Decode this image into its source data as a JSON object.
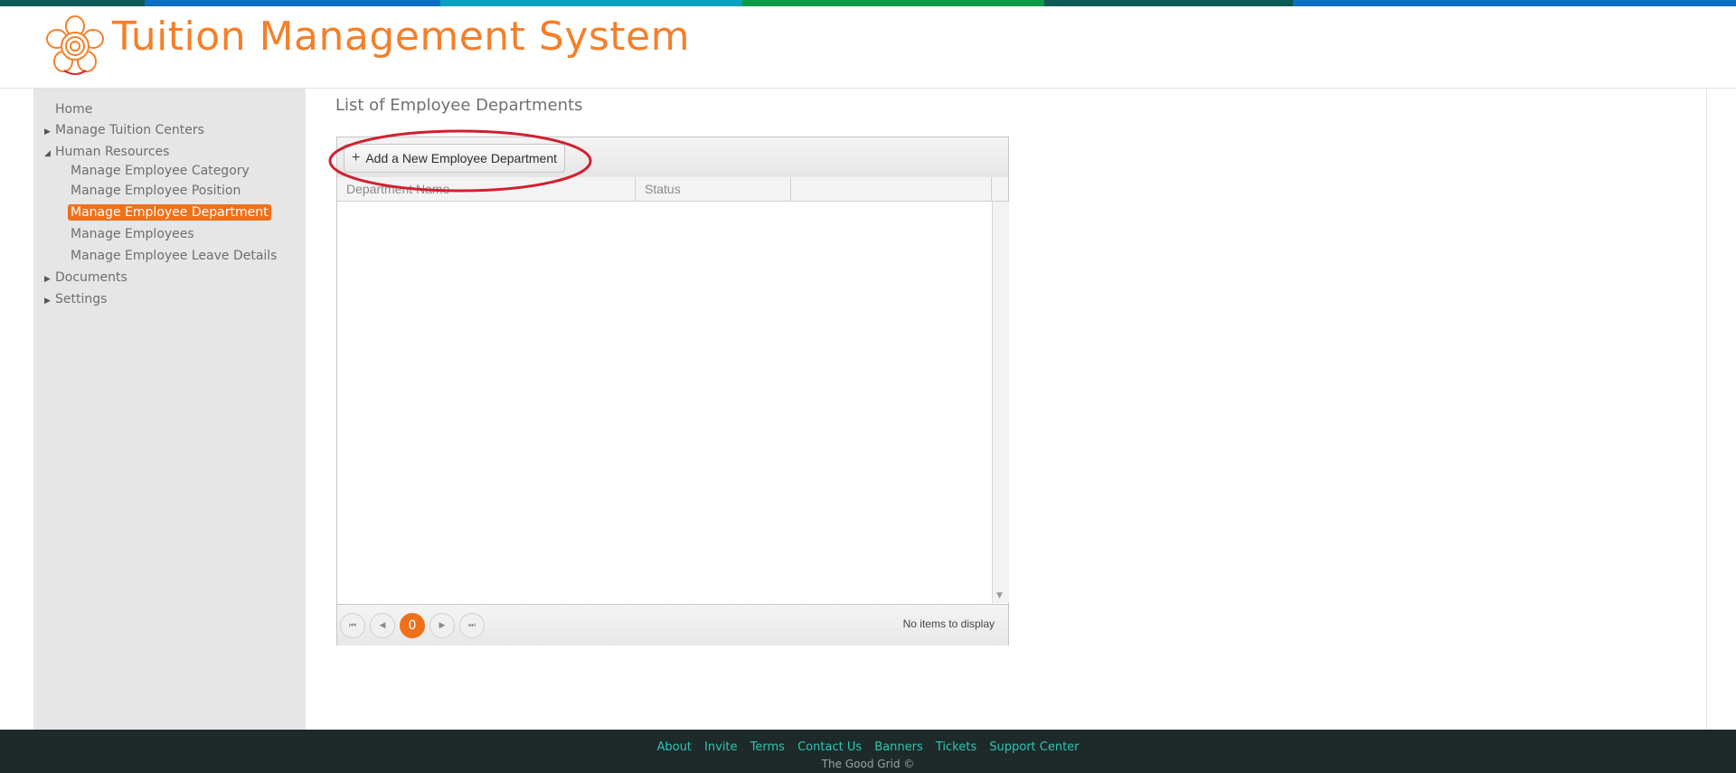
{
  "colors": {
    "accent": "#f57f29",
    "active_nav": "#f0701a",
    "footer_bg": "#1e2a2a",
    "footer_link": "#2fc4b4",
    "annotation": "#d0202f",
    "stripe": [
      "#0b5a55",
      "#0c6fc4",
      "#0aa0c0",
      "#0a9a45",
      "#0b5a55",
      "#0c6fc4"
    ]
  },
  "header": {
    "title": "Tuition Management System",
    "logo_icon": "flower-logo-icon"
  },
  "sidebar": {
    "items": [
      {
        "label": "Home"
      },
      {
        "label": "Manage Tuition Centers",
        "expander": "collapsed"
      },
      {
        "label": "Human Resources",
        "expander": "expanded",
        "children": [
          {
            "label": "Manage Employee Category"
          },
          {
            "label": "Manage Employee Position"
          },
          {
            "label": "Manage Employee Department",
            "active": true
          },
          {
            "label": "Manage Employees"
          },
          {
            "label": "Manage Employee Leave Details"
          }
        ]
      },
      {
        "label": "Documents",
        "expander": "collapsed"
      },
      {
        "label": "Settings",
        "expander": "collapsed"
      }
    ]
  },
  "main": {
    "title": "List of Employee Departments",
    "toolbar": {
      "add_label": "Add a New Employee Department",
      "add_icon": "plus-icon"
    },
    "columns": [
      "Department Name",
      "Status",
      ""
    ],
    "rows": [],
    "pager": {
      "current_page": "0",
      "info": "No items to display",
      "icons": [
        "first-page-icon",
        "prev-page-icon",
        "next-page-icon",
        "last-page-icon"
      ]
    }
  },
  "footer": {
    "links": [
      "About",
      "Invite",
      "Terms",
      "Contact Us",
      "Banners",
      "Tickets",
      "Support Center"
    ],
    "copyright": "The Good Grid ©"
  }
}
